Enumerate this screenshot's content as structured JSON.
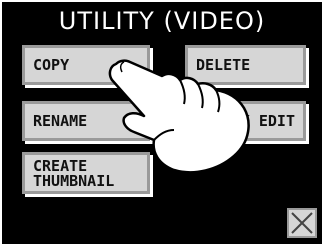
{
  "screen": {
    "title": "UTILITY (VIDEO)",
    "buttons": {
      "copy": "COPY",
      "delete": "DELETE",
      "rename": "RENAME",
      "mark_edit": "MARK EDIT",
      "create_thumbnail": "CREATE\nTHUMBNAIL"
    },
    "close_icon": "close-x-icon",
    "overlay_icon": "pointing-hand-icon"
  }
}
